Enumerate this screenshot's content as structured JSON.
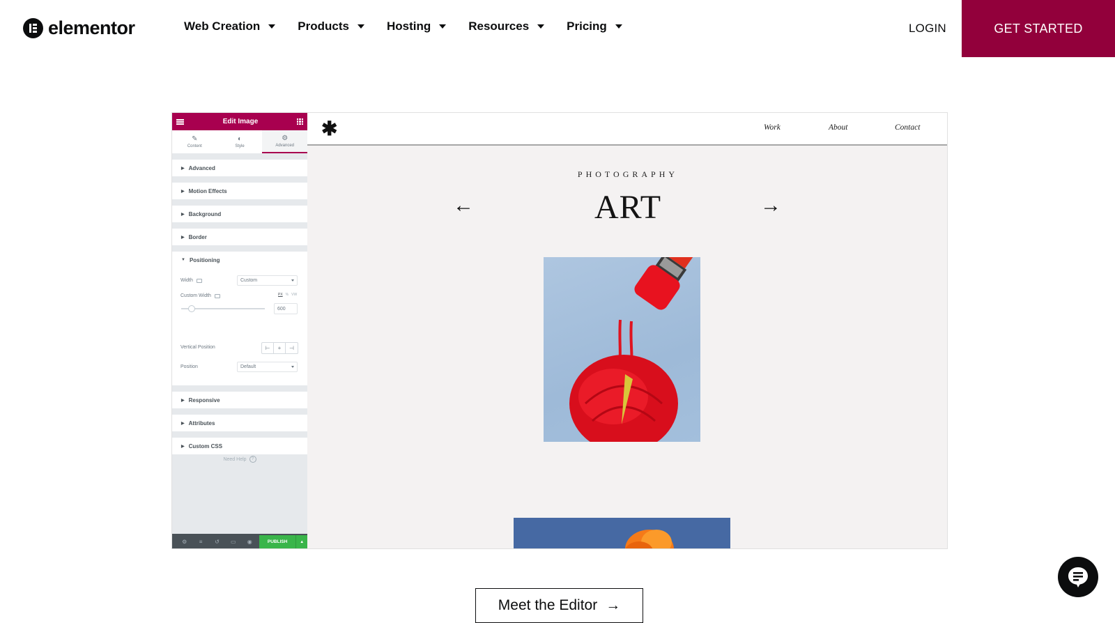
{
  "header": {
    "logo_text": "elementor",
    "menu": [
      {
        "label": "Web Creation"
      },
      {
        "label": "Products"
      },
      {
        "label": "Hosting"
      },
      {
        "label": "Resources"
      },
      {
        "label": "Pricing"
      }
    ],
    "login_label": "LOGIN",
    "cta_label": "GET STARTED",
    "brand_color": "#92003b"
  },
  "editor_panel": {
    "title": "Edit Image",
    "tabs": [
      {
        "label": "Content",
        "icon": "pencil-icon"
      },
      {
        "label": "Style",
        "icon": "contrast-icon"
      },
      {
        "label": "Advanced",
        "icon": "gear-icon",
        "active": true
      }
    ],
    "sections_top": [
      {
        "label": "Advanced"
      },
      {
        "label": "Motion Effects"
      },
      {
        "label": "Background"
      },
      {
        "label": "Border"
      }
    ],
    "positioning": {
      "label": "Positioning",
      "width_label": "Width",
      "width_value": "Custom",
      "custom_width_label": "Custom Width",
      "units": [
        "PX",
        "%",
        "VW"
      ],
      "active_unit": "PX",
      "custom_width_value": "600",
      "vertical_position_label": "Vertical Position",
      "vertical_options": [
        "⊢",
        "+",
        "⊣"
      ],
      "position_label": "Position",
      "position_value": "Default"
    },
    "sections_bottom": [
      {
        "label": "Responsive"
      },
      {
        "label": "Attributes"
      },
      {
        "label": "Custom CSS"
      }
    ],
    "need_help": "Need Help",
    "publish_label": "PUBLISH",
    "accent_color": "#a8004f",
    "publish_color": "#39b54a"
  },
  "preview": {
    "nav_links": [
      "Work",
      "About",
      "Contact"
    ],
    "eyebrow": "PHOTOGRAPHY",
    "title": "ART",
    "prev_arrow": "←",
    "next_arrow": "→"
  },
  "cta": {
    "label": "Meet the Editor",
    "arrow": "→"
  }
}
